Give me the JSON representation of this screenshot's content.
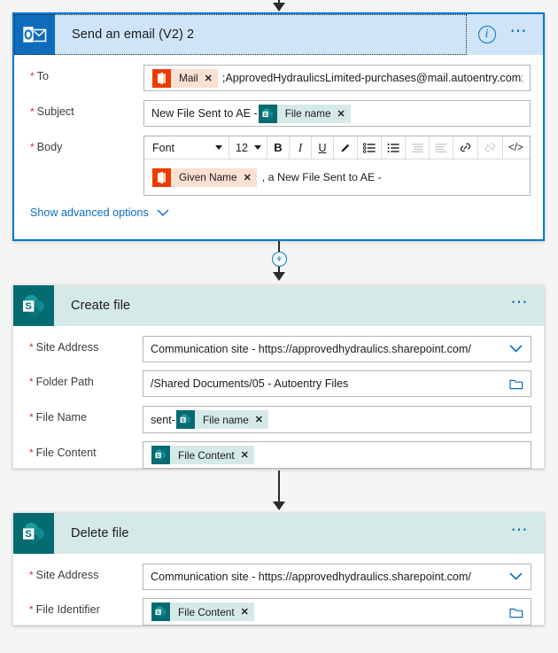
{
  "canvas": {
    "background": "#f5f5f5"
  },
  "connectors": {
    "top_arrow": "arrow-down",
    "between_email_and_create": {
      "plus_label": "+",
      "icon": "add-step-plus-icon"
    },
    "between_create_and_delete": "arrow-down"
  },
  "cards": [
    {
      "id": "send-an-email",
      "title": "Send an email (V2) 2",
      "app_icon": "outlook-icon",
      "selected": true,
      "header_actions": {
        "info": "info-icon",
        "more": "more-options-icon"
      },
      "rows": [
        {
          "label": "To",
          "required": true,
          "type": "token-field",
          "tokens": [
            {
              "icon": "office-365-outlook-icon",
              "label": "Mail",
              "remove": "✕",
              "style": "office"
            }
          ],
          "text_after": ";ApprovedHydraulicsLimited-purchases@mail.autoentry.com;"
        },
        {
          "label": "Subject",
          "required": true,
          "type": "token-field",
          "text_before": "New File Sent to AE - ",
          "tokens": [
            {
              "icon": "sharepoint-icon",
              "label": "File name",
              "remove": "✕",
              "style": "sp"
            }
          ]
        },
        {
          "label": "Body",
          "required": true,
          "type": "rich-text",
          "toolbar": {
            "font_name": "Font",
            "font_size": "12",
            "buttons": [
              {
                "name": "bold-icon",
                "glyph": "B",
                "disabled": false
              },
              {
                "name": "italic-icon",
                "glyph": "I",
                "disabled": false
              },
              {
                "name": "underline-icon",
                "glyph": "U",
                "disabled": false
              },
              {
                "name": "text-color-icon",
                "glyph": "✎",
                "disabled": false
              },
              {
                "name": "bulleted-list-icon",
                "glyph": "☰",
                "disabled": false
              },
              {
                "name": "numbered-list-icon",
                "glyph": "☰",
                "disabled": false
              },
              {
                "name": "outdent-icon",
                "glyph": "≡",
                "disabled": true
              },
              {
                "name": "indent-icon",
                "glyph": "≡",
                "disabled": true
              },
              {
                "name": "link-icon",
                "glyph": "🔗",
                "disabled": false
              },
              {
                "name": "unlink-icon",
                "glyph": "🔗",
                "disabled": true
              },
              {
                "name": "code-view-icon",
                "glyph": "</>",
                "disabled": false
              }
            ]
          },
          "tokens": [
            {
              "icon": "office-365-outlook-icon",
              "label": "Given Name",
              "remove": "✕",
              "style": "office"
            }
          ],
          "text_after": ", a New File Sent to AE -"
        }
      ],
      "advanced_options": {
        "label": "Show advanced options",
        "icon": "chevron-down-icon"
      }
    },
    {
      "id": "create-file",
      "title": "Create file",
      "app_icon": "sharepoint-icon",
      "selected": false,
      "header_actions": {
        "more": "more-options-icon"
      },
      "rows": [
        {
          "label": "Site Address",
          "required": true,
          "type": "dropdown",
          "value": "Communication site - https://approvedhydraulics.sharepoint.com/",
          "icon": "chevron-down-icon"
        },
        {
          "label": "Folder Path",
          "required": true,
          "type": "text-with-picker",
          "value": "/Shared Documents/05 - Autoentry Files",
          "icon": "folder-picker-icon"
        },
        {
          "label": "File Name",
          "required": true,
          "type": "token-field",
          "text_before": "sent-",
          "tokens": [
            {
              "icon": "sharepoint-icon",
              "label": "File name",
              "remove": "✕",
              "style": "sp"
            }
          ]
        },
        {
          "label": "File Content",
          "required": true,
          "type": "token-field",
          "tokens": [
            {
              "icon": "sharepoint-icon",
              "label": "File Content",
              "remove": "✕",
              "style": "sp"
            }
          ]
        }
      ]
    },
    {
      "id": "delete-file",
      "title": "Delete file",
      "app_icon": "sharepoint-icon",
      "selected": false,
      "header_actions": {
        "more": "more-options-icon"
      },
      "rows": [
        {
          "label": "Site Address",
          "required": true,
          "type": "dropdown",
          "value": "Communication site - https://approvedhydraulics.sharepoint.com/",
          "icon": "chevron-down-icon"
        },
        {
          "label": "File Identifier",
          "required": true,
          "type": "token-field-with-picker",
          "tokens": [
            {
              "icon": "sharepoint-icon",
              "label": "File Content",
              "remove": "✕",
              "style": "sp"
            }
          ],
          "icon": "folder-picker-icon"
        }
      ]
    }
  ],
  "colors": {
    "accent_blue": "#0078d4",
    "outlook_tile": "#0f6cbd",
    "outlook_header": "#cfe4f7",
    "sharepoint_tile": "#046b70",
    "sharepoint_header": "#d6e9e9",
    "office_token": "#eb3c00",
    "required_red": "#d93025"
  }
}
